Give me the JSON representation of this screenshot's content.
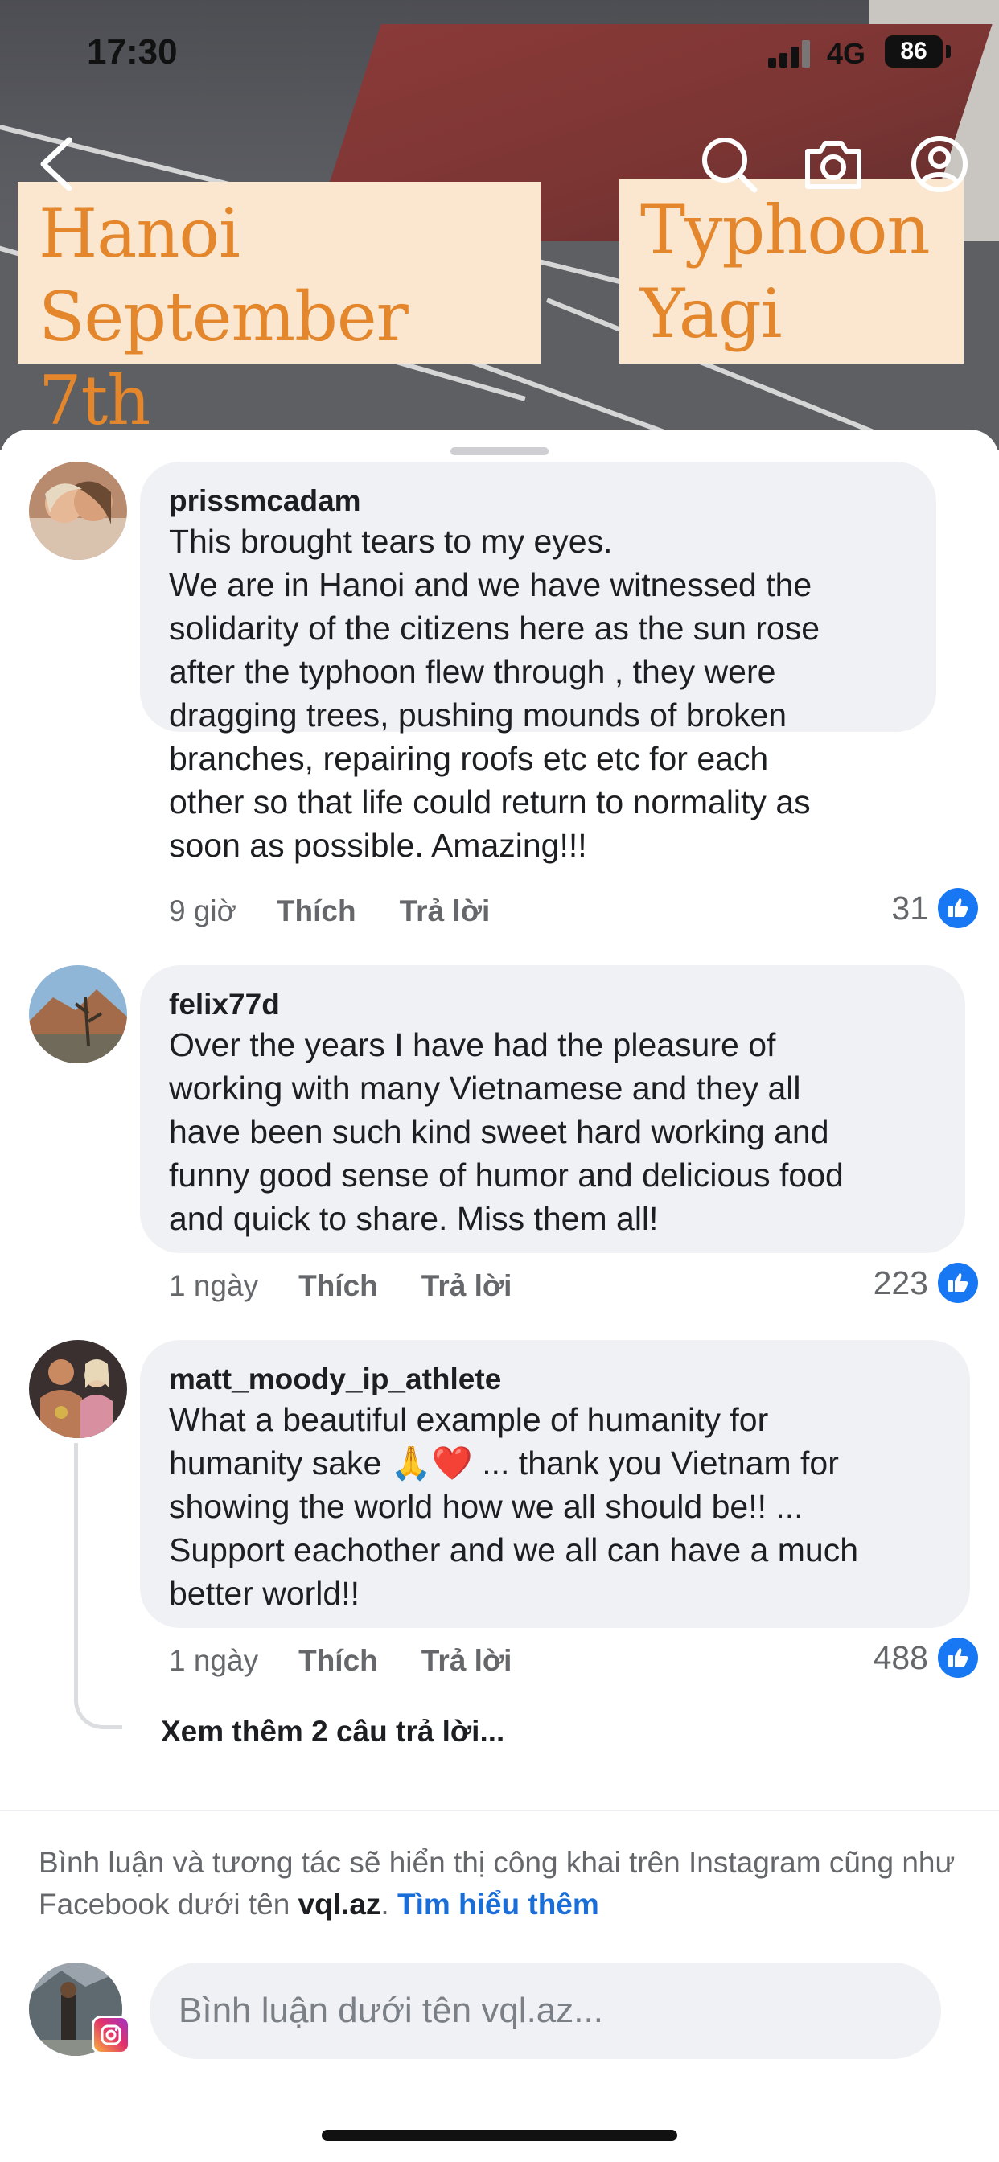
{
  "status_bar": {
    "time": "17:30",
    "network": "4G",
    "battery": "86"
  },
  "video": {
    "caption_left": "Hanoi\nSeptember 7th",
    "caption_right": "Typhoon\nYagi"
  },
  "icons": {
    "back": "back-chevron-icon",
    "search": "search-icon",
    "camera": "camera-icon",
    "profile": "profile-icon",
    "like": "thumbs-up-icon"
  },
  "colors": {
    "like_blue": "#1877f2",
    "link_blue": "#1a6ed8",
    "bubble_bg": "#f0f1f4",
    "caption_text": "#e3862c",
    "caption_bg": "#fbe6cf"
  },
  "comments": [
    {
      "username": "prissmcadam",
      "text": "This brought tears to my eyes.\nWe are in Hanoi and we have witnessed the\nsolidarity of the citizens here as the sun rose\nafter the typhoon flew through , they were\ndragging trees, pushing mounds of broken\nbranches, repairing roofs etc etc for each\nother so that life could return to normality as\nsoon as possible. Amazing!!!",
      "time": "9 giờ",
      "like_label": "Thích",
      "reply_label": "Trả lời",
      "likes": "31"
    },
    {
      "username": "felix77d",
      "text": "Over the years I have had the pleasure of\nworking with many Vietnamese and they all\nhave been such kind sweet hard working and\nfunny good sense of humor and delicious food\nand quick to share. Miss them all!",
      "time": "1 ngày",
      "like_label": "Thích",
      "reply_label": "Trả lời",
      "likes": "223"
    },
    {
      "username": "matt_moody_ip_athlete",
      "text": "What a beautiful example of humanity for\nhumanity sake 🙏❤️ ... thank you Vietnam for\nshowing the world how we all should be!! ...\nSupport eachother and we all can have a much\nbetter world!!",
      "time": "1 ngày",
      "like_label": "Thích",
      "reply_label": "Trả lời",
      "likes": "488",
      "more_replies": "Xem thêm 2 câu trả lời..."
    }
  ],
  "footer": {
    "notice_prefix": "Bình luận và tương tác sẽ hiển thị công khai trên Instagram cũng như Facebook dưới tên ",
    "handle": "vql.az",
    "notice_sep": ". ",
    "learn_more": "Tìm hiểu thêm",
    "input_placeholder": "Bình luận dưới tên vql.az..."
  }
}
